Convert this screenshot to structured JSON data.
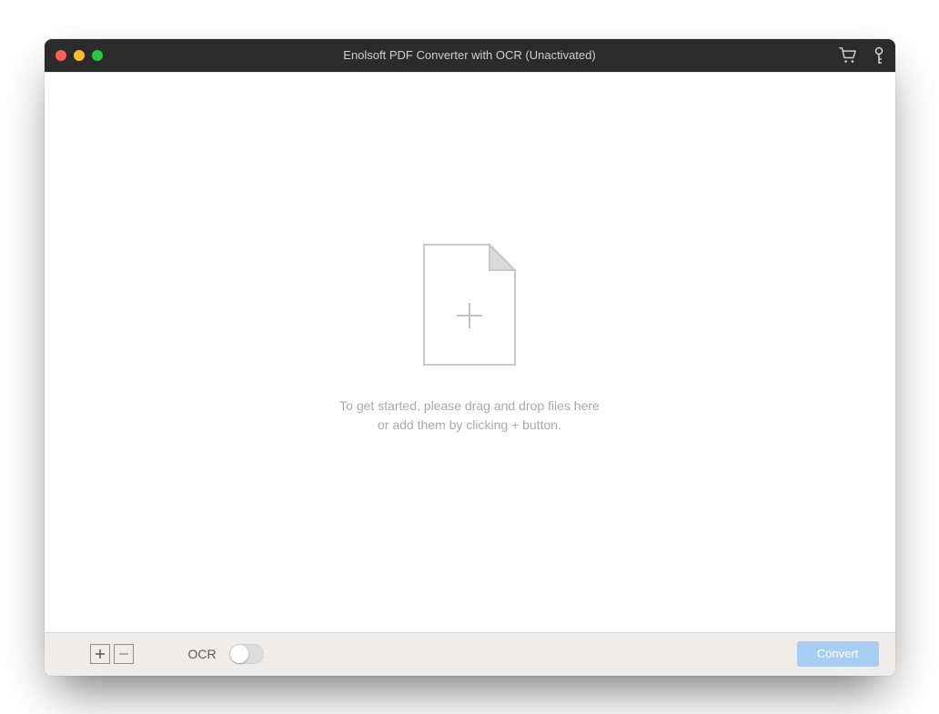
{
  "titlebar": {
    "title": "Enolsoft PDF Converter with OCR (Unactivated)"
  },
  "main": {
    "empty_line1": "To get started, please drag and drop files here",
    "empty_line2": "or add them by clicking + button."
  },
  "bottombar": {
    "ocr_label": "OCR",
    "convert_label": "Convert"
  }
}
